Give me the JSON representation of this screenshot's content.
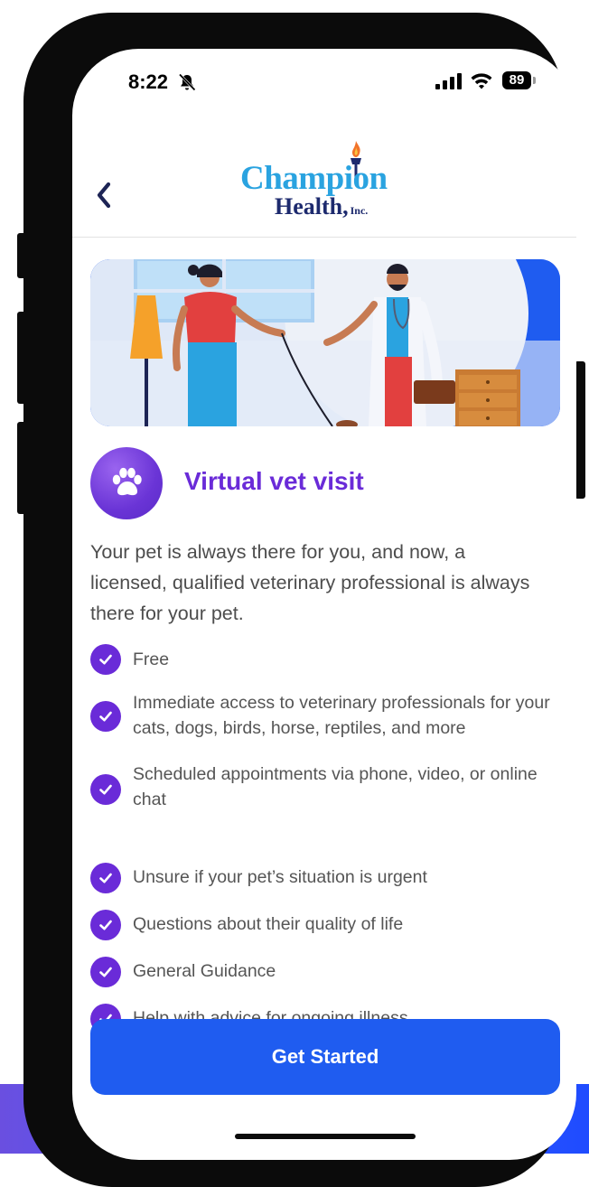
{
  "status_bar": {
    "time": "8:22",
    "battery": "89"
  },
  "header": {
    "back_icon": "chevron-left-icon",
    "logo": {
      "line1": "Champion",
      "line2": "Health,",
      "suffix": "Inc."
    }
  },
  "service": {
    "icon": "paw-icon",
    "title": "Virtual vet visit",
    "description": "Your pet is always there for you, and now, a licensed, qualified veterinary professional is always there for your pet."
  },
  "features": [
    "Free",
    "Immediate access to veterinary professionals for your cats, dogs, birds, horse, reptiles, and more",
    "Scheduled appointments via phone, video, or online chat",
    "Unsure if your pet’s situation is urgent",
    "Questions about their quality of life",
    "General Guidance",
    "Help with advice for ongoing illness"
  ],
  "cta": {
    "label": "Get Started"
  },
  "colors": {
    "accent_purple": "#6a2bd8",
    "brand_blue": "#1f5cf0",
    "logo_light_blue": "#2aa3e0",
    "logo_navy": "#1d2a6e"
  }
}
